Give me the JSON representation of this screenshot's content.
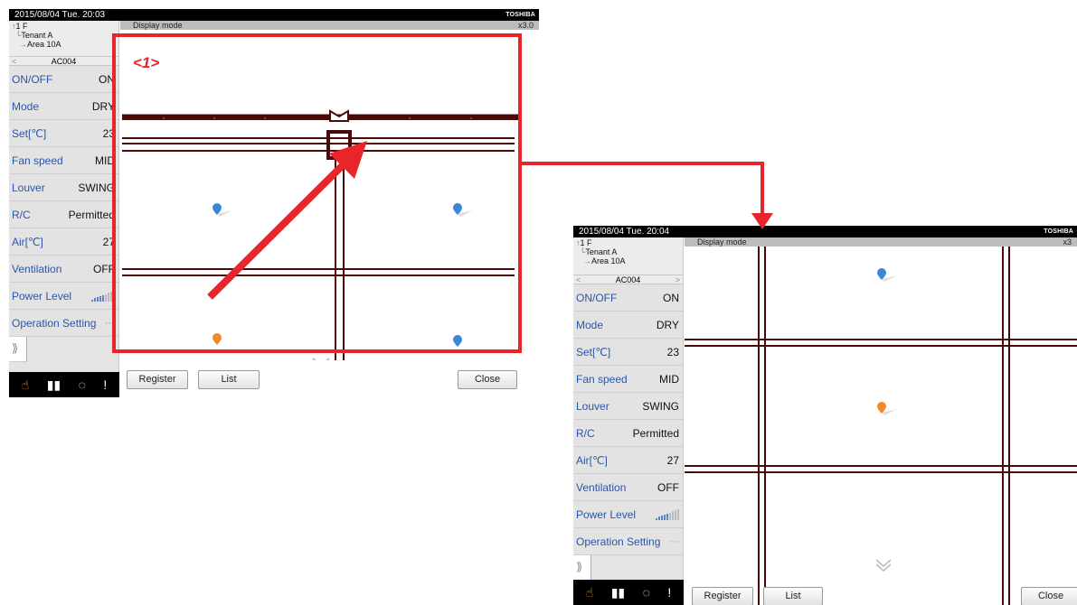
{
  "screen_before": {
    "header": {
      "datetime": "2015/08/04  Tue.  20:03",
      "brand": "TOSHIBA"
    },
    "location_tree": {
      "floor": "1 F",
      "tenant": "Tenant A",
      "area": "Area 10A"
    },
    "device": {
      "name": "AC004"
    },
    "view": {
      "title": "Display mode",
      "zoom": "x3.0"
    },
    "buttons": {
      "register": "Register",
      "list": "List",
      "close": "Close"
    },
    "callout_label": "<1>"
  },
  "screen_after": {
    "header": {
      "datetime": "2015/08/04  Tue.  20:04",
      "brand": "TOSHIBA"
    },
    "location_tree": {
      "floor": "1 F",
      "tenant": "Tenant A",
      "area": "Area 10A"
    },
    "device": {
      "name": "AC004"
    },
    "view": {
      "title": "Display mode",
      "zoom": "x3"
    },
    "buttons": {
      "register": "Register",
      "list": "List",
      "close": "Close"
    }
  },
  "settings": [
    {
      "label": "ON/OFF",
      "value": "ON"
    },
    {
      "label": "Mode",
      "value": "DRY"
    },
    {
      "label": "Set[℃]",
      "value": "23"
    },
    {
      "label": "Fan speed",
      "value": "MID"
    },
    {
      "label": "Louver",
      "value": "SWING"
    },
    {
      "label": "R/C",
      "value": "Permitted"
    },
    {
      "label": "Air[℃]",
      "value": "27"
    },
    {
      "label": "Ventilation",
      "value": "OFF"
    },
    {
      "label": "Power Level",
      "value": ""
    },
    {
      "label": "Operation Setting",
      "value": "···"
    }
  ],
  "power_level_fraction": 0.55,
  "icons": {
    "toolbar": [
      "hand-icon",
      "book-icon",
      "dotted-circle-icon",
      "alert-icon"
    ],
    "expand": "double-chevron-right-icon",
    "scroll": "chevron-down-icon",
    "pins": [
      "blue-unit-pin",
      "orange-unit-pin"
    ]
  },
  "colors": {
    "accent": "#e8252a",
    "wall": "#4a0a0a",
    "label_blue": "#2b55a8",
    "pin_blue": "#3b86d6",
    "pin_orange": "#f08a2a"
  },
  "expand_glyph": "⟫"
}
